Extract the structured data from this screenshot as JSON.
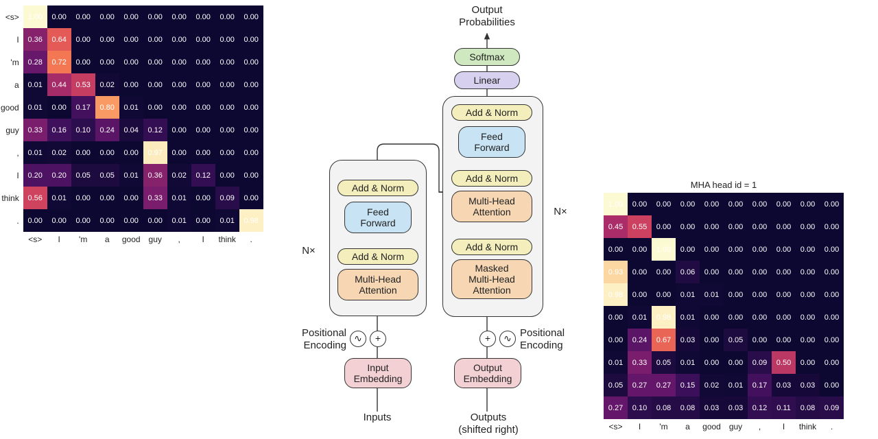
{
  "heatmap_left": {
    "title": "",
    "row_labels": [
      "<s>",
      "I",
      "'m",
      "a",
      "good",
      "guy",
      ",",
      "I",
      "think",
      "."
    ],
    "col_labels": [
      "<s>",
      "I",
      "'m",
      "a",
      "good",
      "guy",
      ",",
      "I",
      "think",
      "."
    ]
  },
  "heatmap_right": {
    "title": "MHA head id = 1",
    "row_labels": [
      "",
      "",
      "",
      "",
      "",
      "",
      "",
      "",
      "",
      ""
    ],
    "col_labels": [
      "<s>",
      "I",
      "'m",
      "a",
      "good",
      "guy",
      ",",
      "I",
      "think",
      "."
    ]
  },
  "diagram": {
    "top_label": "Output\nProbabilities",
    "softmax": "Softmax",
    "linear": "Linear",
    "addnorm": "Add & Norm",
    "feedforward": "Feed\nForward",
    "mha": "Multi-Head\nAttention",
    "masked_mha": "Masked\nMulti-Head\nAttention",
    "input_emb": "Input\nEmbedding",
    "output_emb": "Output\nEmbedding",
    "pos_enc": "Positional\nEncoding",
    "nx": "N×",
    "inputs": "Inputs",
    "outputs": "Outputs\n(shifted right)"
  },
  "chart_data": [
    {
      "type": "heatmap",
      "title": "",
      "xlabel": "",
      "ylabel": "",
      "x_categories": [
        "<s>",
        "I",
        "'m",
        "a",
        "good",
        "guy",
        ",",
        "I",
        "think",
        "."
      ],
      "y_categories": [
        "<s>",
        "I",
        "'m",
        "a",
        "good",
        "guy",
        ",",
        "I",
        "think",
        "."
      ],
      "values": [
        [
          1.0,
          0.0,
          0.0,
          0.0,
          0.0,
          0.0,
          0.0,
          0.0,
          0.0,
          0.0
        ],
        [
          0.36,
          0.64,
          0.0,
          0.0,
          0.0,
          0.0,
          0.0,
          0.0,
          0.0,
          0.0
        ],
        [
          0.28,
          0.72,
          0.0,
          0.0,
          0.0,
          0.0,
          0.0,
          0.0,
          0.0,
          0.0
        ],
        [
          0.01,
          0.44,
          0.53,
          0.02,
          0.0,
          0.0,
          0.0,
          0.0,
          0.0,
          0.0
        ],
        [
          0.01,
          0.0,
          0.17,
          0.8,
          0.01,
          0.0,
          0.0,
          0.0,
          0.0,
          0.0
        ],
        [
          0.33,
          0.16,
          0.1,
          0.24,
          0.04,
          0.12,
          0.0,
          0.0,
          0.0,
          0.0
        ],
        [
          0.01,
          0.02,
          0.0,
          0.0,
          0.0,
          0.97,
          0.0,
          0.0,
          0.0,
          0.0
        ],
        [
          0.2,
          0.2,
          0.05,
          0.05,
          0.01,
          0.36,
          0.02,
          0.12,
          0.0,
          0.0
        ],
        [
          0.56,
          0.01,
          0.0,
          0.0,
          0.0,
          0.33,
          0.01,
          0.0,
          0.09,
          0.0
        ],
        [
          0.0,
          0.0,
          0.0,
          0.0,
          0.0,
          0.0,
          0.01,
          0.0,
          0.01,
          0.98
        ]
      ]
    },
    {
      "type": "heatmap",
      "title": "MHA head id = 1",
      "xlabel": "",
      "ylabel": "",
      "x_categories": [
        "<s>",
        "I",
        "'m",
        "a",
        "good",
        "guy",
        ",",
        "I",
        "think",
        "."
      ],
      "y_categories": [
        "<s>",
        "I",
        "'m",
        "a",
        "good",
        "guy",
        ",",
        "I",
        "think",
        "."
      ],
      "values": [
        [
          1.0,
          0.0,
          0.0,
          0.0,
          0.0,
          0.0,
          0.0,
          0.0,
          0.0,
          0.0
        ],
        [
          0.45,
          0.55,
          0.0,
          0.0,
          0.0,
          0.0,
          0.0,
          0.0,
          0.0,
          0.0
        ],
        [
          0.0,
          0.0,
          1.0,
          0.0,
          0.0,
          0.0,
          0.0,
          0.0,
          0.0,
          0.0
        ],
        [
          0.93,
          0.0,
          0.0,
          0.06,
          0.0,
          0.0,
          0.0,
          0.0,
          0.0,
          0.0
        ],
        [
          0.98,
          0.0,
          0.0,
          0.01,
          0.01,
          0.0,
          0.0,
          0.0,
          0.0,
          0.0
        ],
        [
          0.0,
          0.01,
          0.98,
          0.01,
          0.0,
          0.0,
          0.0,
          0.0,
          0.0,
          0.0
        ],
        [
          0.0,
          0.24,
          0.67,
          0.03,
          0.0,
          0.05,
          0.0,
          0.0,
          0.0,
          0.0
        ],
        [
          0.01,
          0.33,
          0.05,
          0.01,
          0.0,
          0.0,
          0.09,
          0.5,
          0.0,
          0.0
        ],
        [
          0.05,
          0.27,
          0.27,
          0.15,
          0.02,
          0.01,
          0.17,
          0.03,
          0.03,
          0.0
        ],
        [
          0.27,
          0.1,
          0.08,
          0.08,
          0.03,
          0.03,
          0.12,
          0.11,
          0.08,
          0.09
        ]
      ]
    }
  ]
}
